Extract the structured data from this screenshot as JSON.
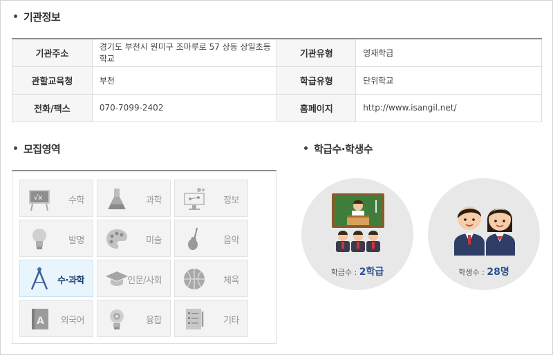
{
  "sections": {
    "info_title": "기관정보",
    "fields_title": "모집영역",
    "stats_title": "학급수·학생수"
  },
  "info": {
    "rows": [
      {
        "l1": "기관주소",
        "v1": "경기도 부천시 원미구 조마루로 57 상동 상일초등학교",
        "l2": "기관유형",
        "v2": "영재학급"
      },
      {
        "l1": "관할교육청",
        "v1": "부천",
        "l2": "학급유형",
        "v2": "단위학교"
      },
      {
        "l1": "전화/팩스",
        "v1": "070-7099-2402",
        "l2": "홈페이지",
        "v2": "http://www.isangil.net/"
      }
    ]
  },
  "fields": [
    {
      "label": "수학",
      "icon": "blackboard-math-icon",
      "active": false
    },
    {
      "label": "과학",
      "icon": "flask-icon",
      "active": false
    },
    {
      "label": "정보",
      "icon": "monitor-network-icon",
      "active": false
    },
    {
      "label": "발명",
      "icon": "lightbulb-icon",
      "active": false
    },
    {
      "label": "미술",
      "icon": "palette-icon",
      "active": false
    },
    {
      "label": "음악",
      "icon": "violin-icon",
      "active": false
    },
    {
      "label": "수·과학",
      "icon": "compass-icon",
      "active": true
    },
    {
      "label": "인문/사회",
      "icon": "graduation-cap-icon",
      "active": false
    },
    {
      "label": "체육",
      "icon": "basketball-icon",
      "active": false
    },
    {
      "label": "외국어",
      "icon": "book-a-icon",
      "active": false
    },
    {
      "label": "융합",
      "icon": "gear-brain-icon",
      "active": false
    },
    {
      "label": "기타",
      "icon": "checklist-icon",
      "active": false
    }
  ],
  "stats": {
    "classes_label": "학급수 : ",
    "classes_value": "2학급",
    "students_label": "학생수 : ",
    "students_value": "28명"
  },
  "colors": {
    "active_label": "#1f3f74",
    "stat_value": "#2a4f8f",
    "active_cell": "#e8f5fc"
  }
}
